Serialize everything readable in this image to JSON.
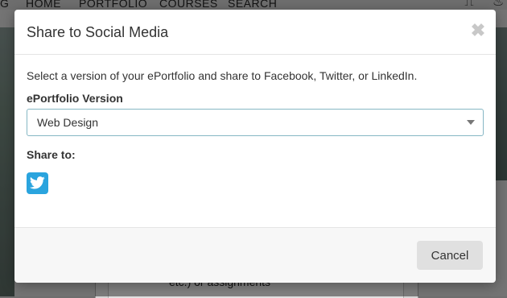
{
  "background": {
    "nav": {
      "items": [
        "G",
        "HOME",
        "PORTFOLIO",
        "COURSES",
        "SEARCH"
      ]
    },
    "content_text": "etc.) or assignments"
  },
  "modal": {
    "title": "Share to Social Media",
    "close_icon": "close-icon",
    "description": "Select a version of your ePortfolio and share to Facebook, Twitter, or LinkedIn.",
    "version_label": "ePortfolio Version",
    "version_selected": "Web Design",
    "share_label": "Share to:",
    "share_icons": [
      "twitter-icon"
    ],
    "cancel_label": "Cancel"
  },
  "colors": {
    "twitter": "#2aa4de",
    "select_border": "#86b7c4",
    "overlay": "rgba(0,0,0,0.42)"
  }
}
